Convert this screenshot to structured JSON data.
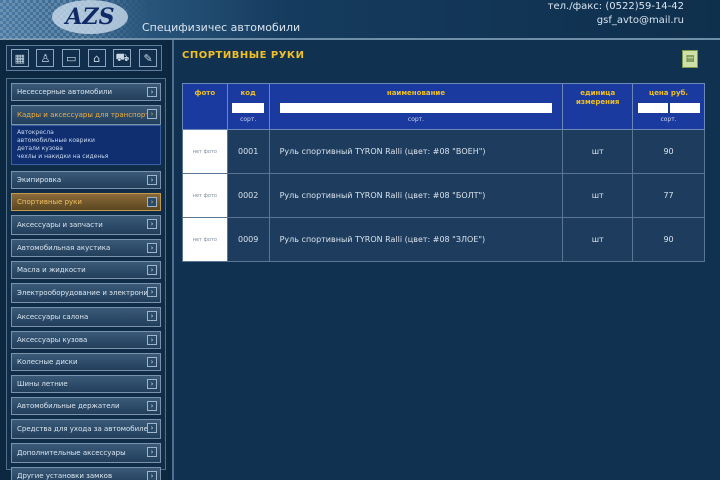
{
  "header": {
    "logo": "AZS",
    "slogan": "Специфизичес автомобили",
    "phone": "тел./факс: (0522)59-14-42",
    "email": "gsf_avto@mail.ru"
  },
  "toolbar": {
    "icons": [
      "table-icon",
      "person-icon",
      "card-icon",
      "home-icon",
      "cart-icon",
      "tool-icon"
    ]
  },
  "menu": {
    "items": [
      {
        "label": "Несессерные автомобили"
      },
      {
        "label": "Кадры и аксессуары для транспорта"
      },
      {
        "label": "Экипировка"
      },
      {
        "label": "Спортивные руки"
      },
      {
        "label": "Аксессуары и запчасти"
      },
      {
        "label": "Автомобильная акустика"
      },
      {
        "label": "Масла и жидкости"
      },
      {
        "label": "Электрооборудование и электроника"
      },
      {
        "label": "Аксессуары салона"
      },
      {
        "label": "Аксессуары кузова"
      },
      {
        "label": "Колесные диски"
      },
      {
        "label": "Шины летние"
      },
      {
        "label": "Автомобильные держатели"
      },
      {
        "label": "Средства для ухода за автомобилем"
      },
      {
        "label": "Дополнительные аксессуары"
      },
      {
        "label": "Другие установки замков"
      }
    ],
    "submenu": "Автокресла\nавтомобильные коврики\nдетали кузова\nчехлы и накидки на сиденья"
  },
  "main": {
    "title": "СПОРТИВНЫЕ РУКИ",
    "columns": {
      "photo": "фото",
      "code": "код",
      "name": "наименование",
      "unit": "единица измерения",
      "price": "цена руб."
    },
    "sort_label": "сорт.",
    "rows": [
      {
        "photo": "нет фото",
        "code": "0001",
        "name": "Руль спортивный TYRON Ralli (цвет: #08 \"ВОЕН\")",
        "unit": "шт",
        "price": "90"
      },
      {
        "photo": "нет фото",
        "code": "0002",
        "name": "Руль спортивный TYRON Ralli (цвет: #08 \"БОЛТ\")",
        "unit": "шт",
        "price": "77"
      },
      {
        "photo": "нет фото",
        "code": "0009",
        "name": "Руль спортивный TYRON Ralli (цвет: #08 \"ЗЛОЕ\")",
        "unit": "шт",
        "price": "90"
      }
    ]
  },
  "colors": {
    "accent": "#f2c025",
    "header_blue": "#1a3aa0"
  }
}
